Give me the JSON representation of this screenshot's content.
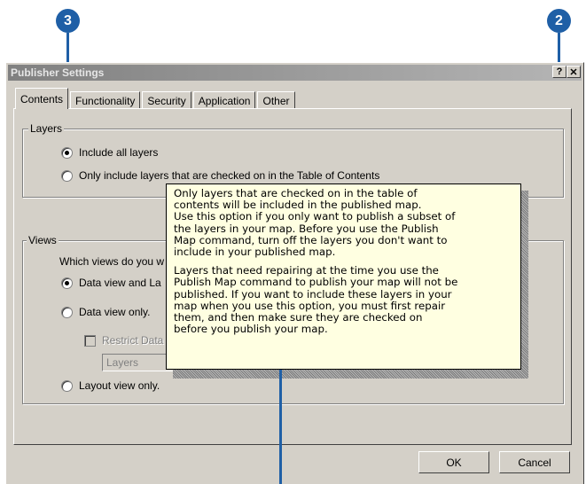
{
  "callouts": [
    "3",
    "2"
  ],
  "dialog": {
    "title": "Publisher Settings",
    "help_btn": "?",
    "close_btn": "✕",
    "tabs": [
      "Contents",
      "Functionality",
      "Security",
      "Application",
      "Other"
    ],
    "layers_group": {
      "label": "Layers",
      "option1": "Include all layers",
      "option2": "Only include layers that are checked on in the Table of Contents"
    },
    "views_group": {
      "label": "Views",
      "question": "Which views do you w",
      "option1": "Data view and La",
      "option2": "Data view only.",
      "restrict": "Restrict Data",
      "combo_value": "Layers",
      "option3": "Layout view only."
    },
    "ok": "OK",
    "cancel": "Cancel"
  },
  "tooltip": {
    "para1": "Only layers that are checked on in the table of\ncontents will be included in the published map.\nUse this option if you only want to publish a subset of\nthe layers in your map. Before you use the Publish\nMap command, turn off the layers you don't want to\ninclude in your published map.",
    "para2": "Layers that need repairing at the time you use the\nPublish Map command to publish your map will not be\npublished. If you want to include these layers in your\nmap when you use this option, you must first repair\nthem, and then make sure they are checked on\nbefore you publish your map."
  },
  "colors": {
    "callout": "#1f5fa6",
    "dialog": "#d4d0c8",
    "tooltip": "#ffffe1"
  }
}
